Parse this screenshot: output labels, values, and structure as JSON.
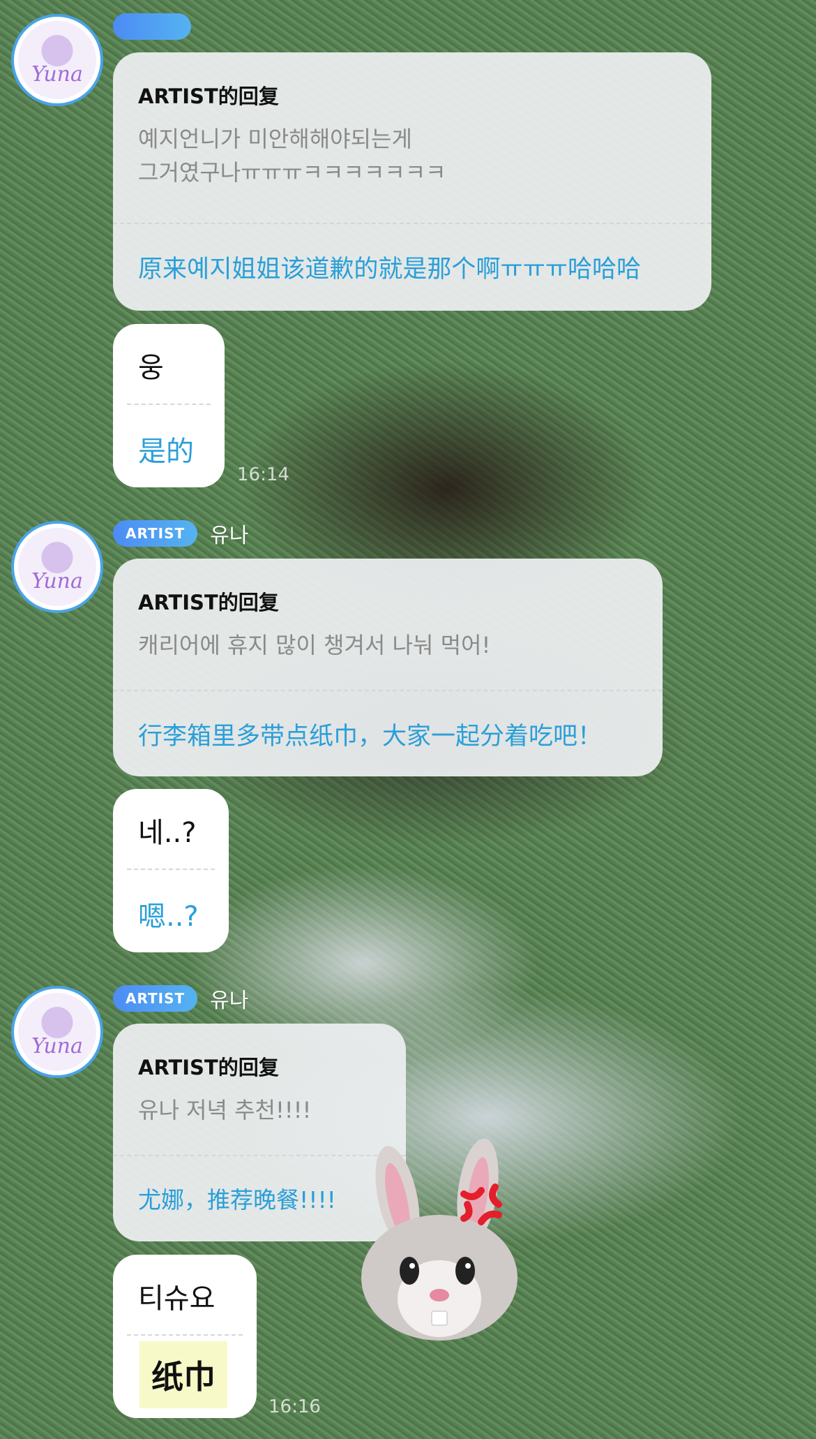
{
  "messages": [
    {
      "sender": {
        "badge": "",
        "name": ""
      },
      "reply": {
        "heading": "ARTIST的回复",
        "original": "예지언니가 미안해해야되는게\n그거였구나ㅠㅠㅠㅋㅋㅋㅋㅋㅋㅋ",
        "translation": "原来예지姐姐该道歉的就是那个啊ㅠㅠㅠ哈哈哈"
      },
      "followup": {
        "original": "웅",
        "translation": "是的",
        "time": "16:14"
      }
    },
    {
      "sender": {
        "badge": "ARTIST",
        "name": "유나"
      },
      "reply": {
        "heading": "ARTIST的回复",
        "original": "캐리어에 휴지 많이 챙겨서 나눠 먹어!",
        "translation": "行李箱里多带点纸巾，大家一起分着吃吧！"
      },
      "followup": {
        "original": "네..?",
        "translation": "嗯..?"
      }
    },
    {
      "sender": {
        "badge": "ARTIST",
        "name": "유나"
      },
      "reply": {
        "heading": "ARTIST的回复",
        "original": "유나 저녁 추천!!!!",
        "translation": "尤娜，推荐晚餐!!!!"
      },
      "followup": {
        "original": "티슈요",
        "translation": "纸巾",
        "time": "16:16"
      }
    }
  ],
  "avatar_text": "Yuna",
  "sticker": "angry-bunny-emoji"
}
